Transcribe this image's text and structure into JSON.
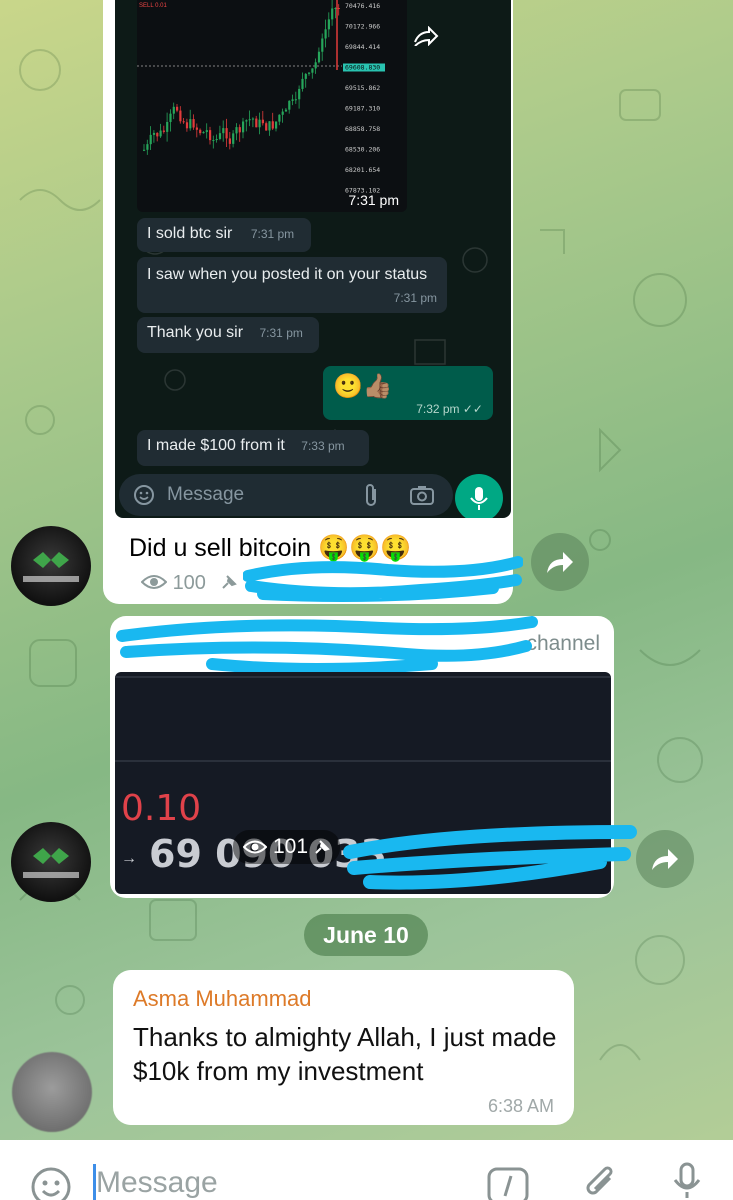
{
  "forwarded_screenshot": {
    "chart": {
      "time": "7:31 pm",
      "price_labels": [
        "70476.416",
        "70172.966",
        "69844.414",
        "69608.830",
        "69515.862",
        "69187.310",
        "68858.758",
        "68530.206",
        "68201.654",
        "67873.102"
      ],
      "top_label": "SELL 0.01"
    },
    "messages": [
      {
        "text": "I sold btc sir",
        "time": "7:31 pm"
      },
      {
        "text": "I saw when you posted it on your status",
        "time": "7:31 pm"
      },
      {
        "text": "Thank you sir",
        "time": "7:31 pm"
      },
      {
        "text": "🙂👍🏽",
        "time": "7:32 pm ✓✓",
        "outgoing": true
      },
      {
        "text": "I made $100 from it",
        "time": "7:33 pm"
      }
    ],
    "input_placeholder": "Message"
  },
  "post1": {
    "caption": "Did u sell bitcoin 🤑🤑🤑",
    "views": "100"
  },
  "post2": {
    "channel_suffix": "channel",
    "value_red": "0.10",
    "value_big": "69 090 033",
    "views": "101"
  },
  "date_separator": "June 10",
  "post3": {
    "sender": "Asma Muhammad",
    "body": "Thanks to almighty Allah, I just made $10k from my investment",
    "time": "6:38 AM"
  },
  "composer": {
    "placeholder": "Message"
  },
  "colors": {
    "sender_orange": "#dd7a28",
    "wa_green": "#00a884",
    "scribble_blue": "#19b8f0"
  }
}
